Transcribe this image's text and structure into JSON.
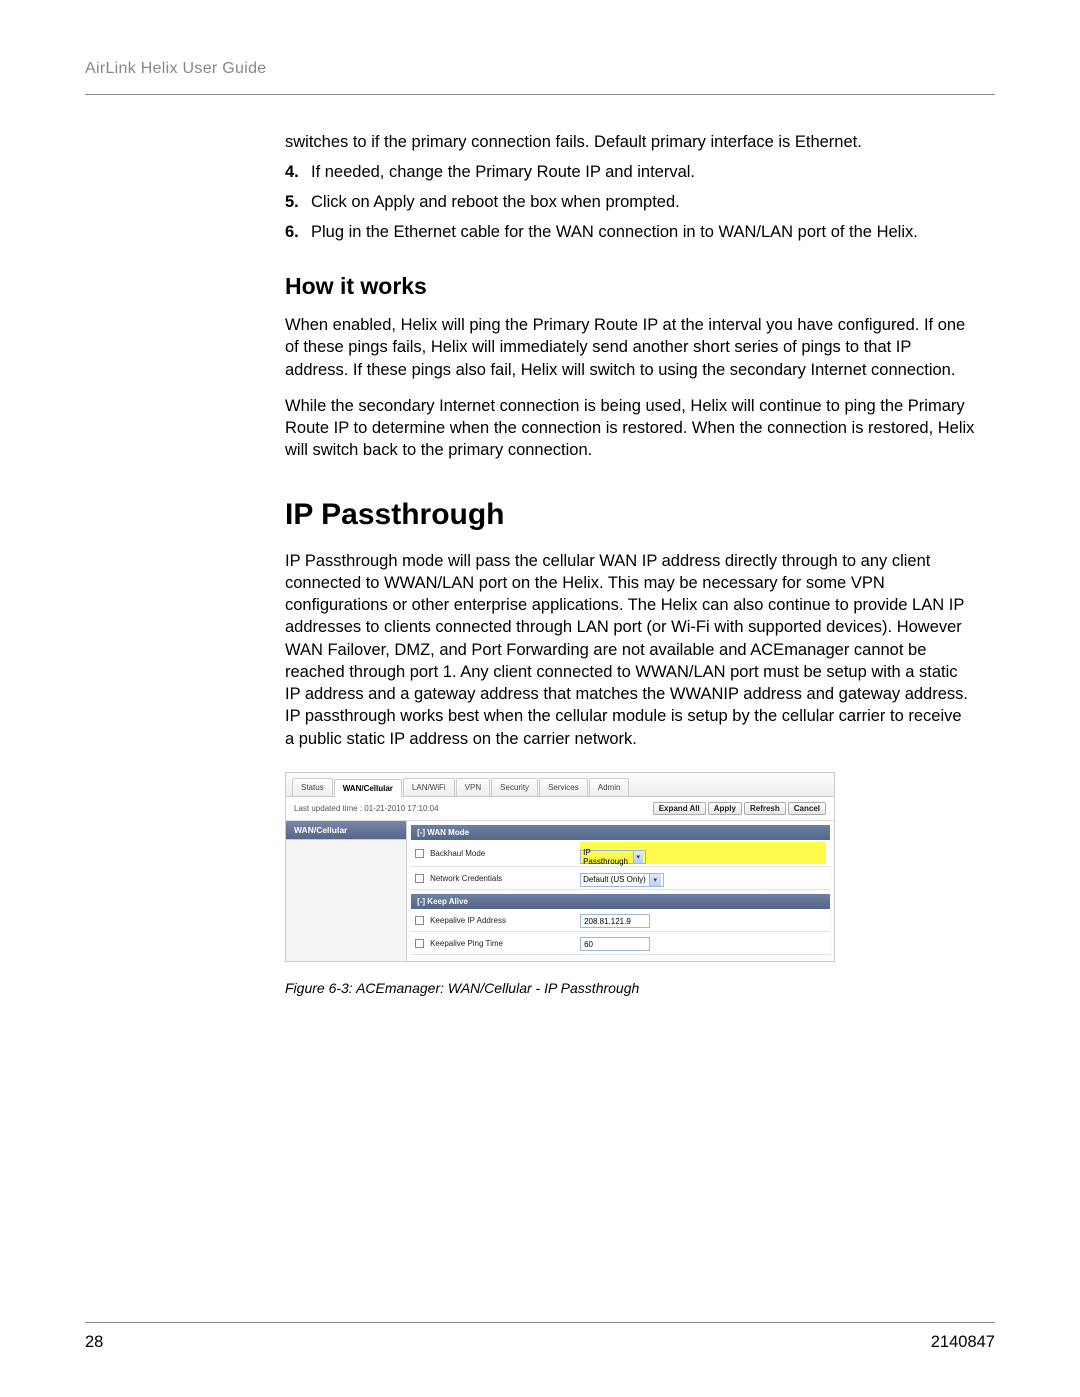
{
  "header": {
    "title": "AirLink Helix User Guide"
  },
  "intro_cont": "switches to if the primary connection fails. Default primary interface is Ethernet.",
  "steps": [
    {
      "n": "4.",
      "t": "If needed, change the Primary Route IP and interval."
    },
    {
      "n": "5.",
      "t": "Click on Apply and reboot the box when prompted."
    },
    {
      "n": "6.",
      "t": "Plug in the Ethernet cable for the WAN connection in to WAN/LAN port of the Helix."
    }
  ],
  "how_heading": "How it works",
  "how_p1": "When enabled, Helix will ping the Primary Route IP at the interval you have configured. If one of these pings fails, Helix will immediately send another short series of pings to that IP address. If these pings also fail, Helix will switch to using the secondary Internet connection.",
  "how_p2": "While the secondary Internet connection is being used, Helix will continue to ping the Primary Route IP to determine when the connection is restored. When the connection is restored, Helix will switch back to the primary connection.",
  "ipp_heading": "IP Passthrough",
  "ipp_para": "IP Passthrough mode will pass the cellular WAN IP address directly through to any client connected to WWAN/LAN port on the Helix. This may be necessary for some VPN configurations or other enterprise applications. The Helix can also continue to provide LAN IP addresses to clients connected through LAN port (or Wi-Fi with supported devices). However WAN Failover, DMZ, and Port Forwarding are not available and ACEmanager cannot be reached through port 1. Any client connected to WWAN/LAN port must be setup with a static IP address and a gateway address that matches the WWANIP address and gateway address. IP passthrough works best when the cellular module is setup by the cellular carrier to receive a public static IP address on the carrier network.",
  "ui": {
    "tabs": [
      "Status",
      "WAN/Cellular",
      "LAN/WiFi",
      "VPN",
      "Security",
      "Services",
      "Admin"
    ],
    "active_tab": 1,
    "last_updated": "Last updated time : 01-21-2010 17:10:04",
    "buttons": {
      "expand": "Expand All",
      "apply": "Apply",
      "refresh": "Refresh",
      "cancel": "Cancel"
    },
    "sidebar_item": "WAN/Cellular",
    "group1": "[-] WAN Mode",
    "row_backhaul": {
      "label": "Backhaul Mode",
      "value": "IP Passthrough"
    },
    "row_netcred": {
      "label": "Network Credentials",
      "value": "Default (US Only)"
    },
    "group2": "[-] Keep Alive",
    "row_kip": {
      "label": "Keepalive IP Address",
      "value": "208.81.121.9"
    },
    "row_kpt": {
      "label": "Keepalive Ping Time",
      "value": "60"
    }
  },
  "figure_caption": "Figure 6-3:  ACEmanager: WAN/Cellular - IP Passthrough",
  "footer": {
    "page": "28",
    "docnum": "2140847"
  }
}
